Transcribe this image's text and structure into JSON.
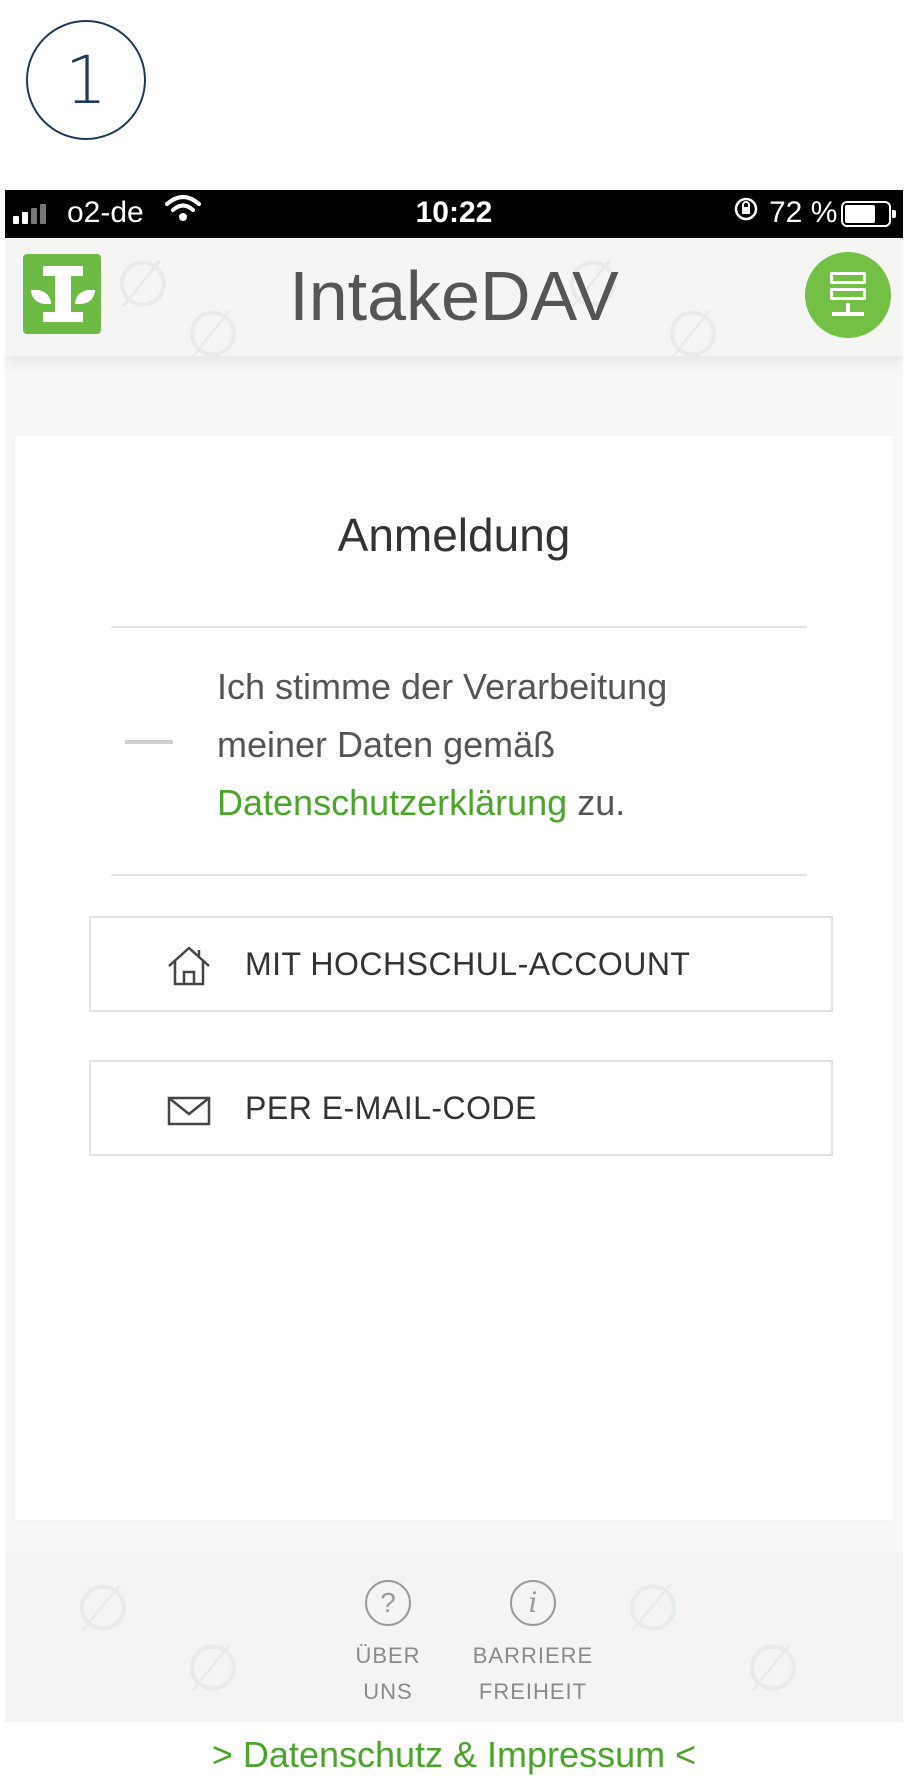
{
  "step": {
    "number": "1"
  },
  "status_bar": {
    "carrier": "o2-de",
    "wifi_icon": "wifi-icon",
    "time": "10:22",
    "orientation_lock_icon": "orientation-lock-icon",
    "battery": "72 %",
    "battery_level_percent": 72
  },
  "header": {
    "title": "IntakeDAV",
    "logo_icon": "intake-logo-icon",
    "server_icon": "server-icon",
    "accent_color": "#74c045"
  },
  "login": {
    "title": "Anmeldung",
    "consent": {
      "text_before": "Ich stimme der Verarbeitung meiner Daten gemäß",
      "link": "Datenschutzerklärung",
      "text_after": " zu."
    },
    "buttons": [
      {
        "label": "MIT HOCHSCHUL-ACCOUNT",
        "icon": "home-icon"
      },
      {
        "label": "PER E-MAIL-CODE",
        "icon": "mail-icon"
      }
    ]
  },
  "bottom_nav": {
    "items": [
      {
        "icon_glyph": "?",
        "icon": "help-icon",
        "line1": "ÜBER",
        "line2": "UNS"
      },
      {
        "icon_glyph": "i",
        "icon": "info-icon",
        "line1": "BARRIERE",
        "line2": "FREIHEIT"
      }
    ]
  },
  "footer": {
    "link": "> Datenschutz & Impressum <"
  },
  "colors": {
    "link_green": "#4aa52a",
    "step_navy": "#1e3a56"
  }
}
